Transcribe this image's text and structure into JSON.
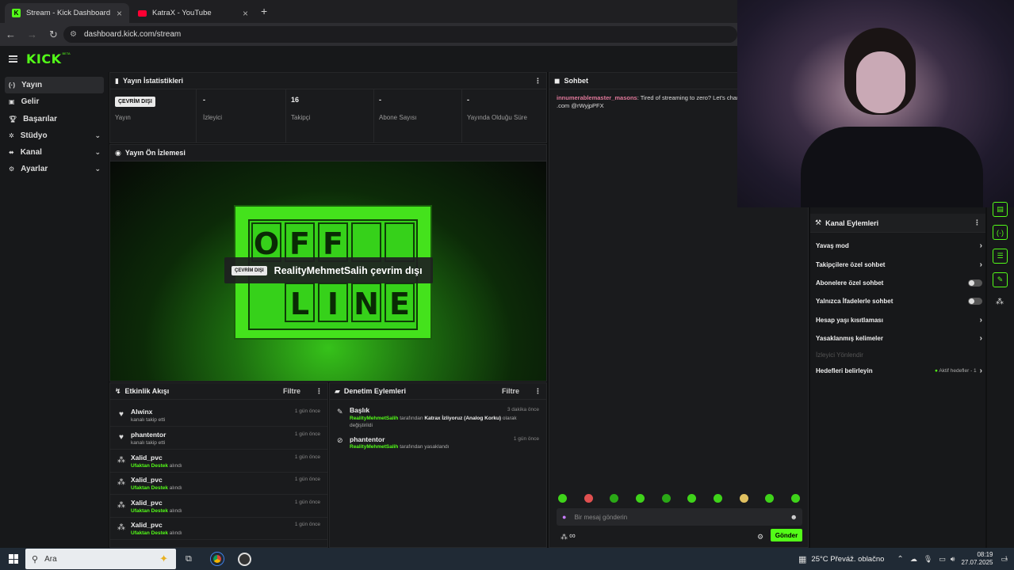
{
  "browser": {
    "tabs": [
      {
        "title": "Stream - Kick Dashboard",
        "active": true
      },
      {
        "title": "KatraX - YouTube",
        "active": false
      }
    ],
    "url": "dashboard.kick.com/stream"
  },
  "brand": {
    "logo": "KICK",
    "beta": "BETA",
    "accent": "#53fc18"
  },
  "sidebar": {
    "items": [
      {
        "label": "Yayın",
        "icon": "broadcast-icon",
        "active": true
      },
      {
        "label": "Gelir",
        "icon": "wallet-icon"
      },
      {
        "label": "Başarılar",
        "icon": "trophy-icon"
      },
      {
        "label": "Stüdyo",
        "icon": "studio-icon",
        "expandable": true
      },
      {
        "label": "Kanal",
        "icon": "channel-icon",
        "expandable": true
      },
      {
        "label": "Ayarlar",
        "icon": "gear-icon",
        "expandable": true
      }
    ]
  },
  "stats": {
    "title": "Yayın İstatistikleri",
    "badge": "ÇEVRİM DIŞI",
    "items": [
      {
        "label": "Yayın",
        "value": ""
      },
      {
        "label": "İzleyici",
        "value": "-"
      },
      {
        "label": "Takipçi",
        "value": "16"
      },
      {
        "label": "Abone Sayısı",
        "value": "-"
      },
      {
        "label": "Yayında Olduğu Süre",
        "value": "-"
      }
    ]
  },
  "preview": {
    "title": "Yayın Ön İzlemesi",
    "badge": "ÇEVRİM DIŞI",
    "message": "RealityMehmetSalih çevrim dışı",
    "offline_art": [
      "O",
      "F",
      "F",
      "",
      "",
      "L",
      "I",
      "N",
      "E"
    ]
  },
  "activity": {
    "title": "Etkinlik Akışı",
    "filter": "Filtre",
    "rows": [
      {
        "name": "Alwinx",
        "sub_green": "",
        "sub": "kanalı takip etti",
        "time": "1 gün önce",
        "icon": "heart-icon"
      },
      {
        "name": "phantentor",
        "sub_green": "",
        "sub": "kanalı takip etti",
        "time": "1 gün önce",
        "icon": "heart-icon"
      },
      {
        "name": "Xalid_pvc",
        "sub_green": "Ufaktan Destek",
        "sub": "alındı",
        "time": "1 gün önce",
        "icon": "gift-icon"
      },
      {
        "name": "Xalid_pvc",
        "sub_green": "Ufaktan Destek",
        "sub": "alındı",
        "time": "1 gün önce",
        "icon": "gift-icon"
      },
      {
        "name": "Xalid_pvc",
        "sub_green": "Ufaktan Destek",
        "sub": "alındı",
        "time": "1 gün önce",
        "icon": "gift-icon"
      },
      {
        "name": "Xalid_pvc",
        "sub_green": "Ufaktan Destek",
        "sub": "alındı",
        "time": "1 gün önce",
        "icon": "gift-icon"
      }
    ]
  },
  "moderation": {
    "title": "Denetim Eylemleri",
    "filter": "Filtre",
    "rows": [
      {
        "name": "Başlık",
        "actor": "RealityMehmetSalih",
        "mid": " tarafından ",
        "bold": "Katrax İzliyoruz (Analog Korku)",
        "end": " olarak değiştirildi",
        "time": "3 dakika önce",
        "icon": "title-edit-icon"
      },
      {
        "name": "phantentor",
        "actor": "RealityMehmetSalih",
        "mid": " tarafından yasaklandı",
        "bold": "",
        "end": "",
        "time": "1 gün önce",
        "icon": "ban-icon"
      }
    ]
  },
  "chat": {
    "title": "Sohbet",
    "messages": [
      {
        "user": "innumerablemaster_masons",
        "text": ": Tired of streaming to zero? Let's chang",
        "line2": ".com @rWyjpPFX"
      }
    ],
    "placeholder": "Bir mesaj gönderin",
    "send": "Gönder",
    "points": "∞"
  },
  "channel_actions": {
    "title": "Kanal Eylemleri",
    "items": [
      {
        "label": "Yavaş mod",
        "control": "chevron"
      },
      {
        "label": "Takipçilere özel sohbet",
        "control": "chevron"
      },
      {
        "label": "Abonelere özel sohbet",
        "control": "toggle"
      },
      {
        "label": "Yalnızca İfadelerle sohbet",
        "control": "toggle"
      },
      {
        "label": "Hesap yaşı kısıtlaması",
        "control": "chevron"
      },
      {
        "label": "Yasaklanmış kelimeler",
        "control": "chevron"
      }
    ],
    "section": "İzleyici Yönlendir",
    "goals": {
      "label": "Hedefleri belirleyin",
      "status": "Aktif hedefler - 1"
    }
  },
  "taskbar": {
    "search": "Ara",
    "weather": "25°C  Převáž. oblačno",
    "time": "08:19",
    "date": "27.07.2025",
    "notification_count": "1"
  }
}
